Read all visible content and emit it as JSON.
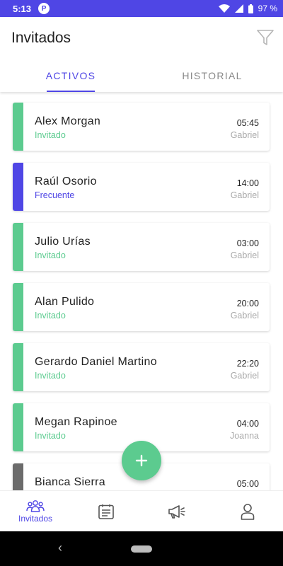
{
  "status_bar": {
    "time": "5:13",
    "app_badge": "P",
    "battery": "97 %"
  },
  "header": {
    "title": "Invitados",
    "tabs": [
      {
        "label": "ACTIVOS",
        "active": true
      },
      {
        "label": "HISTORIAL",
        "active": false
      }
    ]
  },
  "guests": [
    {
      "name": "Alex Morgan",
      "type": "Invitado",
      "time": "05:45",
      "host": "Gabriel",
      "color": "#5ccb8f"
    },
    {
      "name": "Raúl Osorio",
      "type": "Frecuente",
      "time": "14:00",
      "host": "Gabriel",
      "color": "#4f46e5"
    },
    {
      "name": "Julio Urías",
      "type": "Invitado",
      "time": "03:00",
      "host": "Gabriel",
      "color": "#5ccb8f"
    },
    {
      "name": "Alan Pulido",
      "type": "Invitado",
      "time": "20:00",
      "host": "Gabriel",
      "color": "#5ccb8f"
    },
    {
      "name": "Gerardo Daniel Martino",
      "type": "Invitado",
      "time": "22:20",
      "host": "Gabriel",
      "color": "#5ccb8f"
    },
    {
      "name": "Megan Rapinoe",
      "type": "Invitado",
      "time": "04:00",
      "host": "Joanna",
      "color": "#5ccb8f"
    },
    {
      "name": "Bianca Sierra",
      "type": "",
      "time": "05:00",
      "host": "",
      "color": "#6b6b6b"
    }
  ],
  "bottom_nav": {
    "items": [
      {
        "icon": "people-icon",
        "label": "Invitados",
        "active": true
      },
      {
        "icon": "calendar-list-icon",
        "label": "",
        "active": false
      },
      {
        "icon": "megaphone-icon",
        "label": "",
        "active": false
      },
      {
        "icon": "person-icon",
        "label": "",
        "active": false
      }
    ]
  },
  "colors": {
    "primary": "#4f46e5",
    "guest_green": "#5ccb8f",
    "frequent_blue": "#4f46e5",
    "muted": "#aaaaaa"
  }
}
